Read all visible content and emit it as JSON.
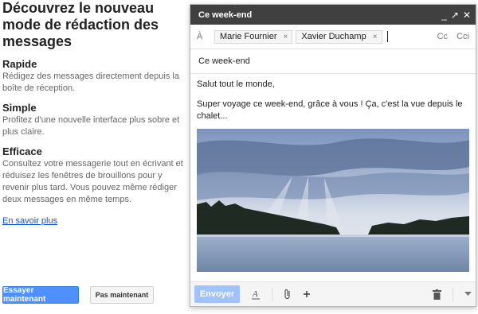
{
  "promo": {
    "headline": "Découvrez le nouveau mode de rédaction des messages",
    "features": [
      {
        "title": "Rapide",
        "desc": "Rédigez des messages directement depuis la boîte de réception."
      },
      {
        "title": "Simple",
        "desc": "Profitez d'une nouvelle interface plus sobre et plus claire."
      },
      {
        "title": "Efficace",
        "desc": "Consultez votre messagerie tout en écrivant et réduisez les fenêtres de brouillons pour y revenir plus tard. Vous pouvez même rédiger deux messages en même temps."
      }
    ],
    "learn_more": "En savoir plus",
    "try_now": "Essayer maintenant",
    "not_now": "Pas maintenant"
  },
  "compose": {
    "title": "Ce week-end",
    "controls": {
      "minimize": "_",
      "popout": "↗",
      "close": "✕"
    },
    "to_label": "À",
    "recipients": [
      "Marie Fournier",
      "Xavier Duchamp"
    ],
    "chip_remove": "×",
    "cc": "Cc",
    "bcc": "Cci",
    "subject": "Ce week-end",
    "body": {
      "greeting": "Salut tout le monde,",
      "text": "Super voyage ce week-end, grâce à vous ! Ça, c'est la vue depuis le chalet..."
    },
    "send": "Envoyer",
    "toolbar_icons": [
      "format-text-icon",
      "attach-icon",
      "plus-icon",
      "trash-icon",
      "chevron-down-icon"
    ]
  }
}
